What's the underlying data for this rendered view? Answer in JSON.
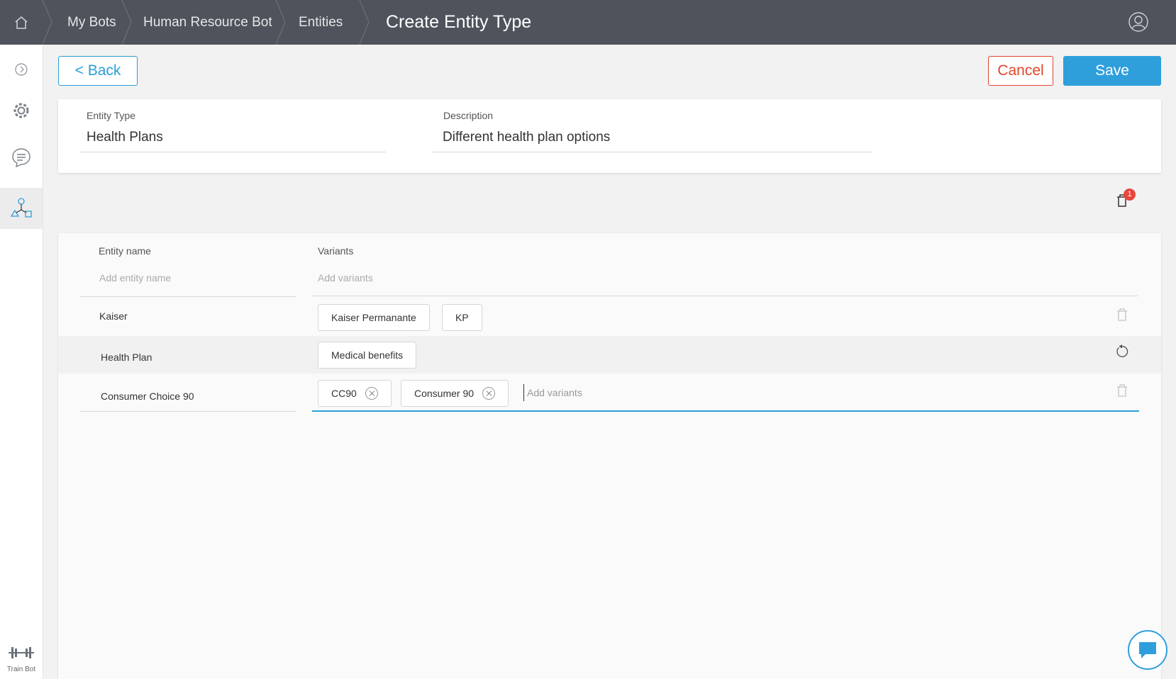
{
  "breadcrumb": {
    "items": [
      "My Bots",
      "Human Resource Bot",
      "Entities"
    ],
    "title": "Create Entity Type"
  },
  "toolbar": {
    "back_label": "< Back",
    "cancel_label": "Cancel",
    "save_label": "Save"
  },
  "entity_type": {
    "type_label": "Entity Type",
    "type_value": "Health Plans",
    "description_label": "Description",
    "description_value": "Different health plan options"
  },
  "trash": {
    "badge_count": "1"
  },
  "entities": {
    "name_header": "Entity name",
    "variants_header": "Variants",
    "name_placeholder": "Add entity name",
    "variants_placeholder": "Add variants",
    "rows": [
      {
        "name": "Kaiser",
        "variants": [
          "Kaiser Permanante",
          "KP"
        ],
        "action": "trash-icon"
      },
      {
        "name": "Health Plan",
        "variants": [
          "Medical benefits"
        ],
        "action": "undo-icon"
      },
      {
        "name": "Consumer Choice 90",
        "variants": [
          "CC90",
          "Consumer 90"
        ],
        "input_placeholder": "Add variants",
        "action": "trash-icon"
      }
    ]
  },
  "sidebar": {
    "train_label": "Train Bot"
  },
  "colors": {
    "topbar": "#4e535c",
    "accent": "#2f9fdc",
    "danger": "#e2452b"
  }
}
